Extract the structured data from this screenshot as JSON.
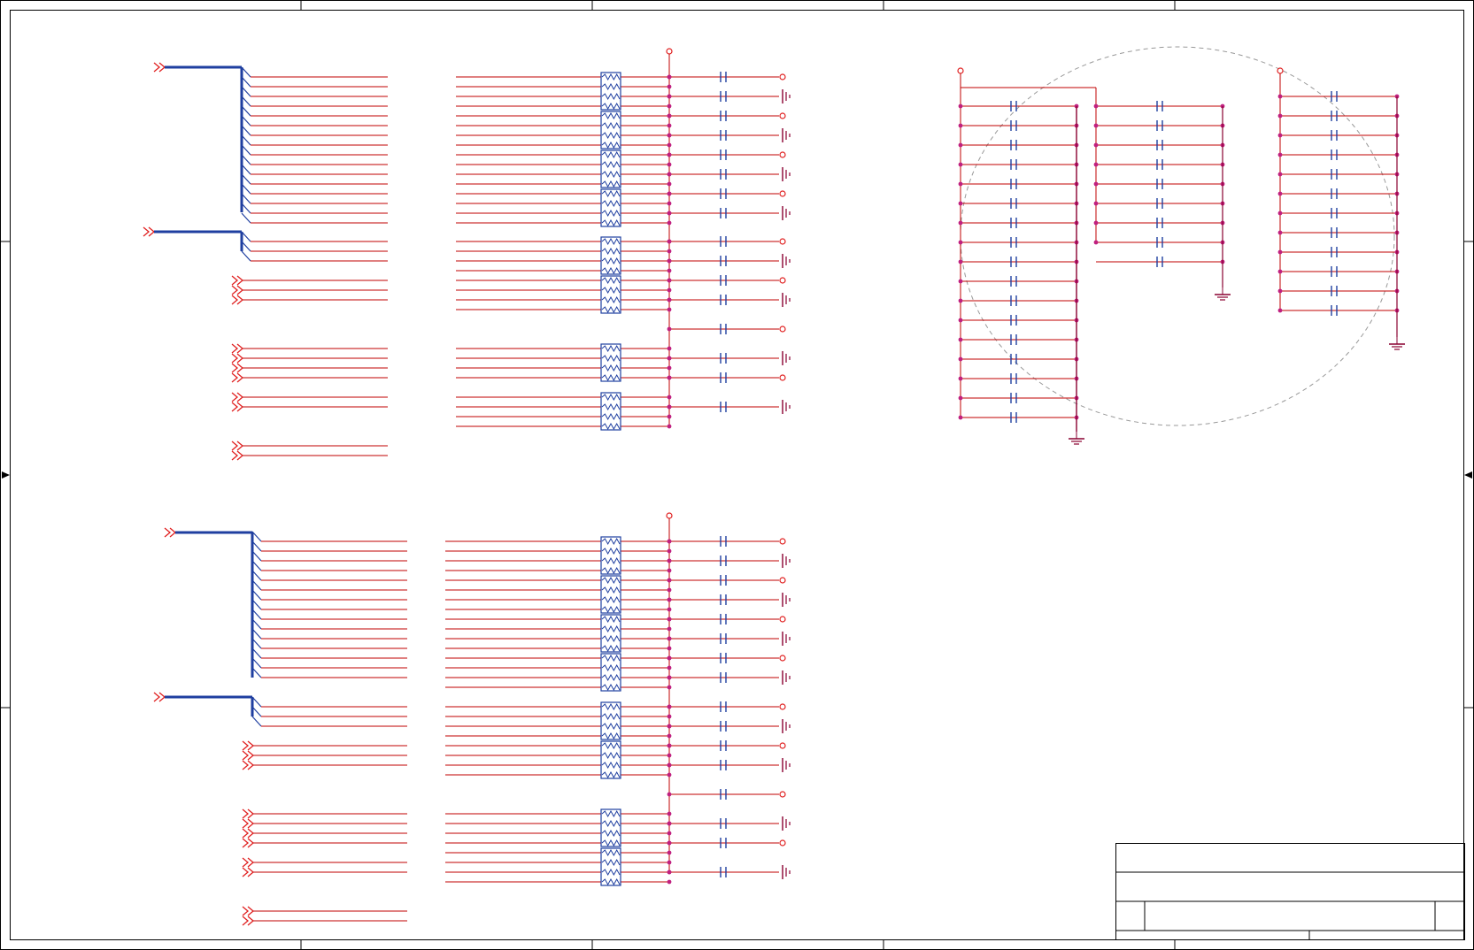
{
  "sheet": {
    "title": "",
    "title_block": {
      "title": "",
      "document": "",
      "size": "",
      "rev": "",
      "date": "",
      "sheet": ""
    },
    "colors": {
      "frame": "#000000",
      "wire": "#c00000",
      "bus": "#1f3fa0",
      "component": "#1f3fa0",
      "junction": "#c02080",
      "port": "#e02020",
      "ground": "#8a0030",
      "guide": "#999999"
    }
  },
  "legend_icons": [
    "bus-entry-icon",
    "off-page-port-icon",
    "resistor-array-icon",
    "capacitor-icon",
    "ground-icon",
    "power-pin-icon",
    "junction-dot-icon"
  ]
}
